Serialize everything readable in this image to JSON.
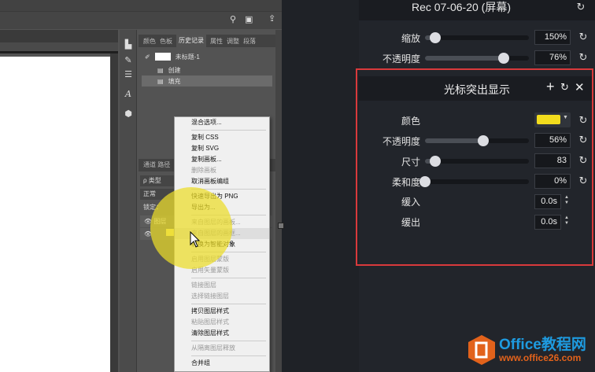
{
  "photoshop": {
    "panel_tabs": [
      "颜色",
      "色板",
      "历史记录",
      "属性",
      "调整",
      "段落"
    ],
    "active_tab": "历史记录",
    "history": {
      "snapshot": "未标题-1",
      "items": [
        "创建",
        "填充"
      ]
    },
    "layers": {
      "tabs": "通道  路径",
      "filter": "ρ 类型",
      "blend": "正常",
      "lock": "锁定：",
      "rows": [
        "图层",
        "图层"
      ]
    },
    "context_menu": [
      {
        "label": "混合选项..."
      },
      {
        "sep": true
      },
      {
        "label": "复制 CSS"
      },
      {
        "label": "复制 SVG"
      },
      {
        "label": "复制画板..."
      },
      {
        "label": "删除画板",
        "disabled": true
      },
      {
        "label": "取消画板编组"
      },
      {
        "sep": true
      },
      {
        "label": "快速导出为 PNG"
      },
      {
        "label": "导出为..."
      },
      {
        "sep": true
      },
      {
        "label": "来自图层的画板...",
        "disabled": true
      },
      {
        "label": "来自图层的画框...",
        "disabled": true,
        "highlight": true
      },
      {
        "label": "转换为智能对象"
      },
      {
        "sep": true
      },
      {
        "label": "启用图层蒙版",
        "disabled": true
      },
      {
        "label": "启用矢量蒙版",
        "disabled": true
      },
      {
        "sep": true
      },
      {
        "label": "链接图层",
        "disabled": true
      },
      {
        "label": "选择链接图层",
        "disabled": true
      },
      {
        "sep": true
      },
      {
        "label": "拷贝图层样式"
      },
      {
        "label": "粘贴图层样式",
        "disabled": true
      },
      {
        "label": "清除图层样式"
      },
      {
        "sep": true
      },
      {
        "label": "从隔离图层释放",
        "disabled": true
      },
      {
        "sep": true
      },
      {
        "label": "合并组"
      }
    ]
  },
  "camtasia": {
    "clip_title": "Rec 07-06-20 (屏幕)",
    "clip_props": [
      {
        "label": "缩放",
        "value": "150%",
        "fraction": 0.1
      },
      {
        "label": "不透明度",
        "value": "76%",
        "fraction": 0.76
      }
    ],
    "effect": {
      "title": "光标突出显示",
      "color_label": "颜色",
      "color": "#f2dc1d",
      "sliders": [
        {
          "label": "不透明度",
          "value": "56%",
          "fraction": 0.56
        },
        {
          "label": "尺寸",
          "value": "83",
          "fraction": 0.1
        },
        {
          "label": "柔和度",
          "value": "0%",
          "fraction": 0
        }
      ],
      "ease_in": {
        "label": "缓入",
        "value": "0.0s"
      },
      "ease_out": {
        "label": "缓出",
        "value": "0.0s"
      }
    },
    "highlight_color": "#d93a3c"
  },
  "watermark": {
    "brand": "Office教程网",
    "url": "www.office26.com"
  }
}
